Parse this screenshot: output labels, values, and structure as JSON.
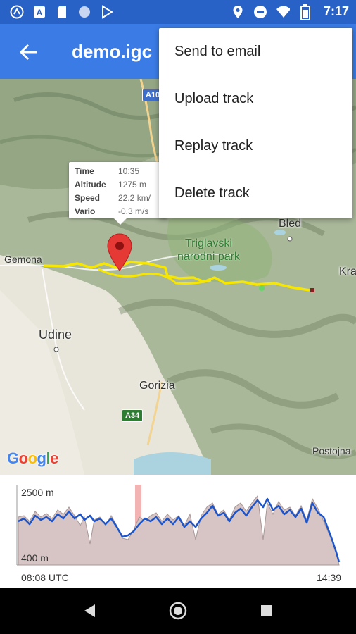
{
  "status_bar": {
    "time": "7:17",
    "left_icons": [
      "assistant-icon",
      "app-a-icon",
      "sd-card-icon",
      "circle-icon",
      "play-store-icon"
    ],
    "right_icons": [
      "location-icon",
      "do-not-disturb-icon",
      "wifi-icon",
      "battery-icon"
    ]
  },
  "app_bar": {
    "title": "demo.igc",
    "back_icon": "arrow-back-icon"
  },
  "menu": {
    "items": [
      {
        "label": "Send to email"
      },
      {
        "label": "Upload track"
      },
      {
        "label": "Replay track"
      },
      {
        "label": "Delete track"
      }
    ]
  },
  "map": {
    "places": {
      "gemona": "Gemona",
      "udine": "Udine",
      "gorizia": "Gorizia",
      "bled": "Bled",
      "kranj": "Kra",
      "postojna": "Postojna"
    },
    "park": [
      "Triglavski",
      "narodni park"
    ],
    "roads": {
      "a10": "A10",
      "a34": "A34"
    },
    "attribution": "Google",
    "marker_icon": "location-pin-icon",
    "track_color": "#f6e600"
  },
  "info_popup": {
    "rows": [
      {
        "key": "Time",
        "value": "10:35"
      },
      {
        "key": "Altitude",
        "value": "1275 m"
      },
      {
        "key": "Speed",
        "value": "22.2 km/"
      },
      {
        "key": "Vario",
        "value": "-0.3 m/s"
      }
    ]
  },
  "elevation_chart": {
    "y_top_label": "2500 m",
    "y_bottom_label": "400 m",
    "x_start_label": "08:08 UTC",
    "x_end_label": "14:39",
    "line_color": "#1e55c8",
    "fill_color": "#d7c4c4",
    "marker_color": "#f09a9a"
  },
  "nav_bar": {
    "back_icon": "nav-back-icon",
    "home_icon": "nav-home-icon",
    "recents_icon": "nav-recents-icon"
  }
}
